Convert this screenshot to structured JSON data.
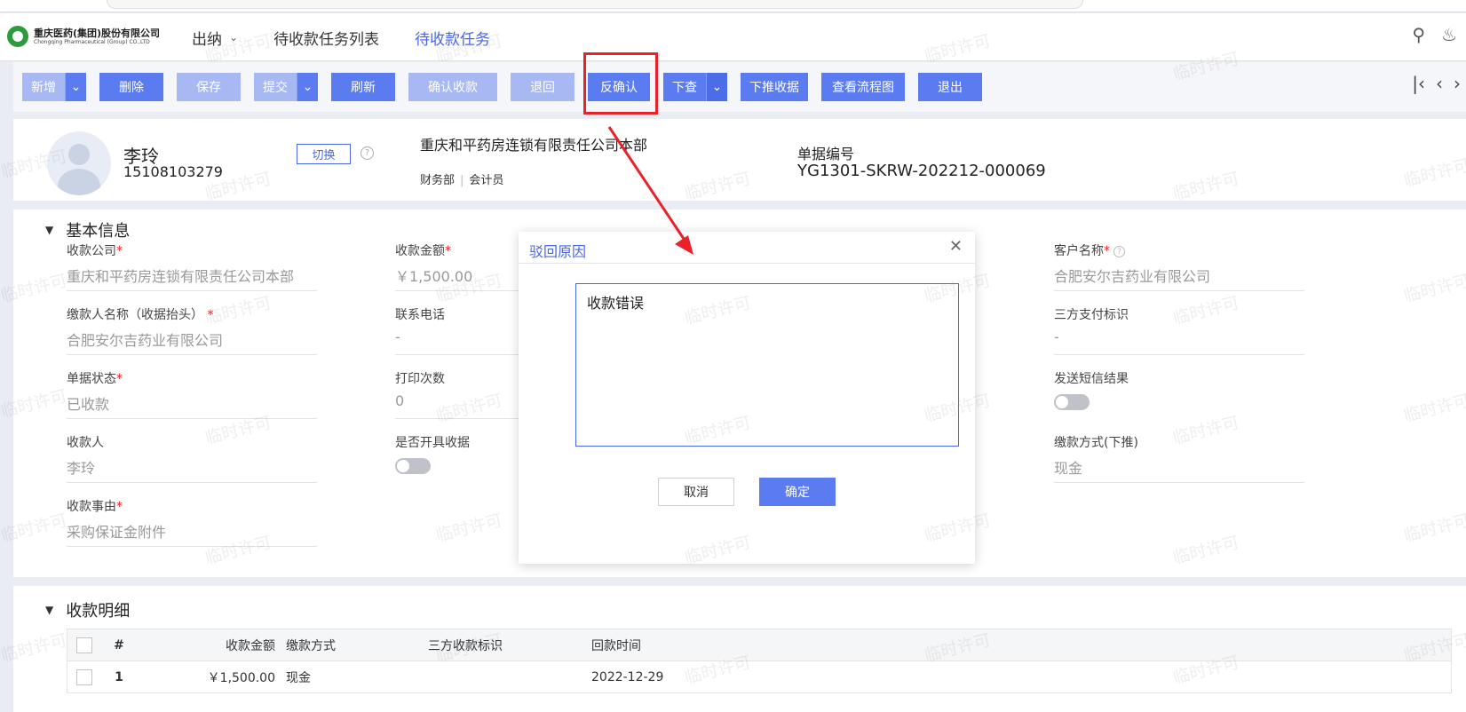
{
  "app": {
    "company_cn": "重庆医药(集团)股份有限公司",
    "company_en": "Chongqing Pharmaceutical (Group) CO.,LTD"
  },
  "nav": {
    "items": [
      {
        "label": "出纳",
        "dropdown": true
      },
      {
        "label": "待收款任务列表"
      },
      {
        "label": "待收款任务",
        "active": true
      }
    ]
  },
  "toolbar": {
    "new": "新增",
    "delete": "删除",
    "save": "保存",
    "submit": "提交",
    "refresh": "刷新",
    "confirm_receipt": "确认收款",
    "return": "退回",
    "unconfirm": "反确认",
    "query_down": "下查",
    "push_receipt": "下推收据",
    "view_flow": "查看流程图",
    "exit": "退出"
  },
  "profile": {
    "name": "李玲",
    "phone": "15108103279",
    "switch": "切换",
    "org": "重庆和平药房连锁有限责任公司本部",
    "dept": "财务部",
    "role": "会计员",
    "doc_label": "单据编号",
    "doc_no": "YG1301-SKRW-202212-000069"
  },
  "basic": {
    "title": "基本信息",
    "fields": {
      "payee_company": {
        "label": "收款公司",
        "value": "重庆和平药房连锁有限责任公司本部"
      },
      "amount": {
        "label": "收款金额",
        "value": "￥1,500.00"
      },
      "customer": {
        "label": "客户名称",
        "value": "合肥安尔吉药业有限公司"
      },
      "payer": {
        "label": "缴款人名称（收据抬头）",
        "value": "合肥安尔吉药业有限公司"
      },
      "phone": {
        "label": "联系电话",
        "value": "-"
      },
      "third_party": {
        "label": "三方支付标识",
        "value": "-"
      },
      "status": {
        "label": "单据状态",
        "value": "已收款"
      },
      "print_count": {
        "label": "打印次数",
        "value": "0"
      },
      "sms_result": {
        "label": "发送短信结果"
      },
      "receiver": {
        "label": "收款人",
        "value": "李玲"
      },
      "issue_receipt": {
        "label": "是否开具收据"
      },
      "pay_method": {
        "label": "缴款方式(下推)",
        "value": "现金"
      },
      "reason": {
        "label": "收款事由",
        "value": "采购保证金附件"
      }
    }
  },
  "detail": {
    "title": "收款明细",
    "columns": [
      "#",
      "收款金额",
      "缴款方式",
      "三方收款标识",
      "回款时间"
    ],
    "rows": [
      {
        "no": "1",
        "amount": "￥1,500.00",
        "method": "现金",
        "third": "",
        "time": "2022-12-29"
      }
    ]
  },
  "dialog": {
    "title": "驳回原因",
    "reason_text": "收款错误",
    "cancel": "取消",
    "ok": "确定"
  },
  "watermark": "临时许可",
  "colors": {
    "primary": "#5b7cf0",
    "primary_disabled": "#a7b8f3",
    "highlight": "#e8222a",
    "accent_text": "#4a66e8"
  }
}
